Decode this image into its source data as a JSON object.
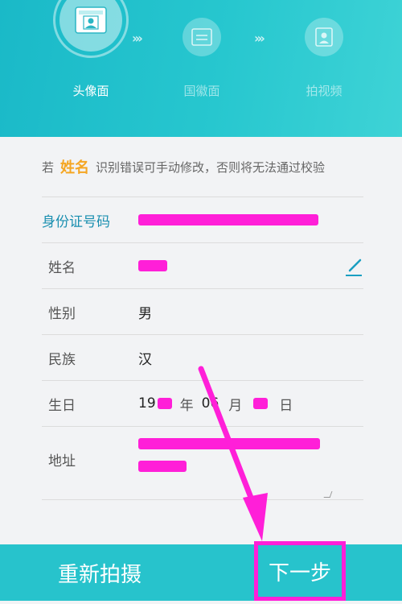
{
  "steps": [
    {
      "label": "头像面",
      "icon": "id-card-front-icon"
    },
    {
      "label": "国徽面",
      "icon": "id-card-back-icon"
    },
    {
      "label": "拍视频",
      "icon": "video-portrait-icon"
    }
  ],
  "notice": {
    "prefix": "若",
    "highlight": "姓名",
    "suffix": "识别错误可手动修改，否则将无法通过校验"
  },
  "form": {
    "id_label": "身份证号码",
    "name_label": "姓名",
    "gender_label": "性别",
    "gender_value": "男",
    "ethnicity_label": "民族",
    "ethnicity_value": "汉",
    "birthday_label": "生日",
    "year_prefix": "19",
    "year_unit": "年",
    "month_value": "06",
    "month_unit": "月",
    "day_unit": "日",
    "address_label": "地址"
  },
  "footer": {
    "retake_label": "重新拍摄",
    "next_label": "下一步"
  },
  "colors": {
    "header": "#27c7cf",
    "accent": "#f5a623",
    "id_label": "#1a8fb0",
    "annotation": "#ff1fd8",
    "footer": "#27c3cc"
  }
}
